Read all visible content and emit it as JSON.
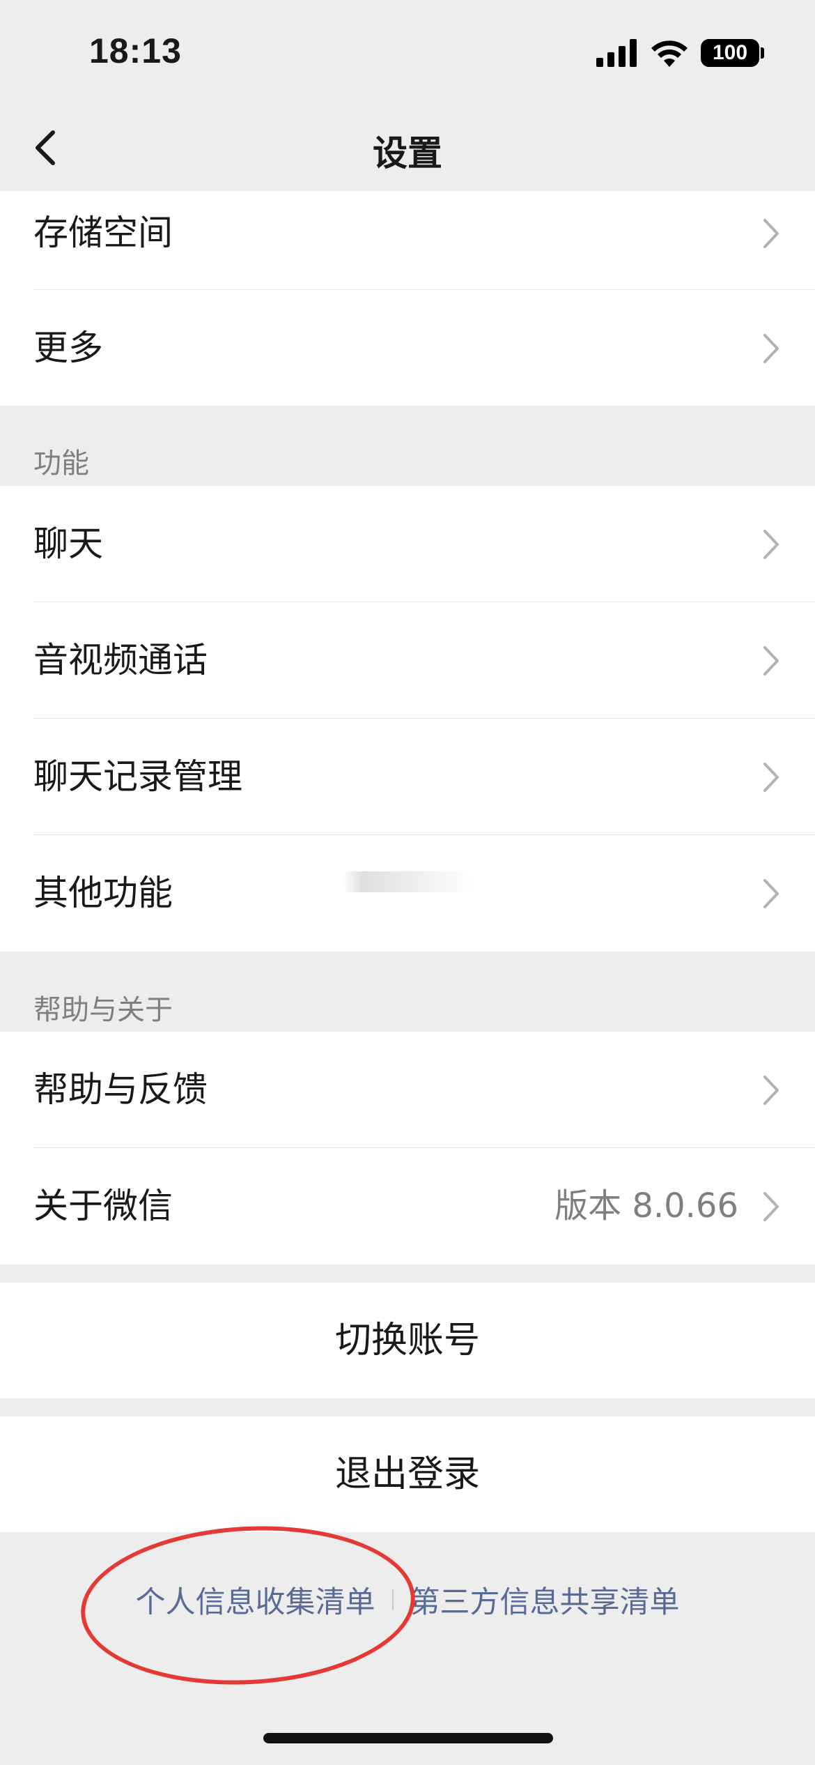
{
  "status_bar": {
    "time": "18:13",
    "battery": "100"
  },
  "nav": {
    "title": "设置"
  },
  "groups": {
    "storage": {
      "items": [
        {
          "label": "存储空间"
        },
        {
          "label": "更多"
        }
      ]
    },
    "features": {
      "header": "功能",
      "items": [
        {
          "label": "聊天"
        },
        {
          "label": "音视频通话"
        },
        {
          "label": "聊天记录管理"
        },
        {
          "label": "其他功能"
        }
      ]
    },
    "help": {
      "header": "帮助与关于",
      "items": [
        {
          "label": "帮助与反馈"
        },
        {
          "label": "关于微信",
          "value": "版本 8.0.66"
        }
      ]
    }
  },
  "actions": {
    "switch_account": "切换账号",
    "logout": "退出登录"
  },
  "footer": {
    "personal_info_list": "个人信息收集清单",
    "third_party_list": "第三方信息共享清单"
  },
  "colors": {
    "background": "#ededed",
    "link": "#576b95",
    "annotation": "#e53935"
  }
}
